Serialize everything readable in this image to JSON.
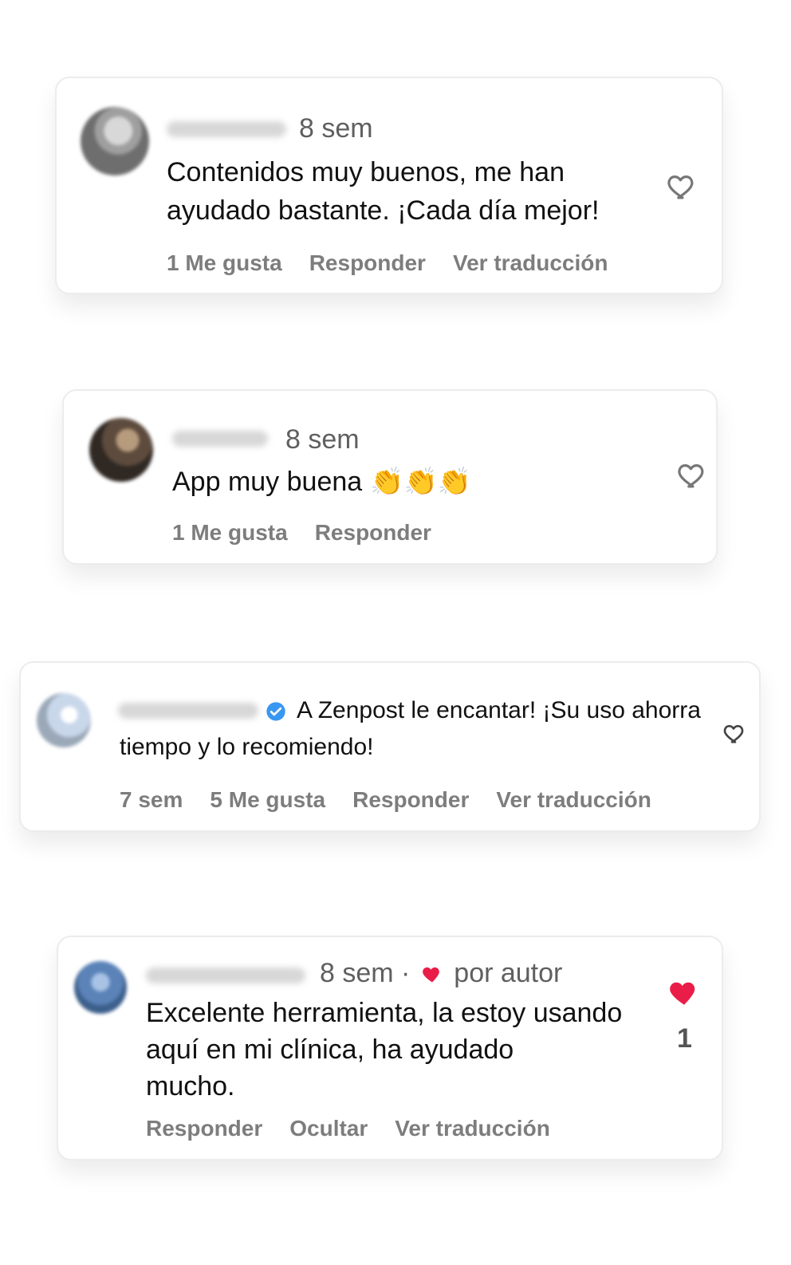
{
  "comments": [
    {
      "time": "8 sem",
      "body_lines": [
        "Contenidos muy buenos, me han",
        "ayudado bastante. ¡Cada día mejor!"
      ],
      "actions": [
        "1 Me gusta",
        "Responder",
        "Ver traducción"
      ],
      "icon": "heart-outline-icon"
    },
    {
      "time": "8 sem",
      "body_lines": [
        "App muy buena"
      ],
      "emoji": "👏👏👏",
      "actions": [
        "1 Me gusta",
        "Responder"
      ],
      "icon": "heart-outline-icon"
    },
    {
      "verified_icon": "verified-badge-icon",
      "body_lines": [
        "A Zenpost le encantar! ¡Su uso ahorra",
        "tiempo y lo recomiendo!"
      ],
      "time": "7 sem",
      "actions": [
        "5 Me gusta",
        "Responder",
        "Ver traducción"
      ],
      "icon": "heart-outline-icon"
    },
    {
      "time": "8 sem",
      "separator": "·",
      "author_label": "por autor",
      "body_lines": [
        "Excelente herramienta, la estoy usando",
        "aquí en mi clínica, ha ayudado",
        "mucho."
      ],
      "actions": [
        "Responder",
        "Ocultar",
        "Ver traducción"
      ],
      "icon": "heart-filled-icon",
      "like_count": "1"
    }
  ],
  "colors": {
    "text": "#111111",
    "meta": "#5f5f5f",
    "muted": "#7d7d7d",
    "heart_red": "#ea1d48",
    "verified_blue": "#3897f0"
  }
}
